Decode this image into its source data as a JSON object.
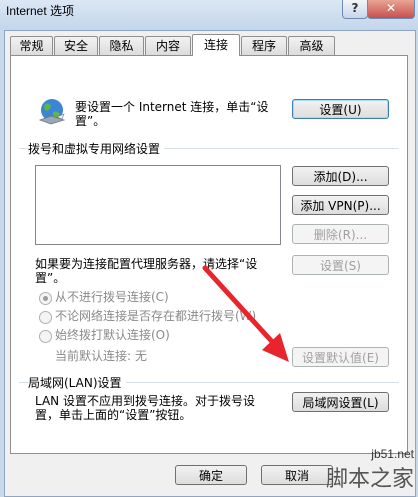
{
  "window": {
    "title": "Internet 选项",
    "help_label": "?",
    "close_label": "✕"
  },
  "tabs": [
    {
      "label": "常规"
    },
    {
      "label": "安全"
    },
    {
      "label": "隐私"
    },
    {
      "label": "内容"
    },
    {
      "label": "连接",
      "active": true
    },
    {
      "label": "程序"
    },
    {
      "label": "高级"
    }
  ],
  "setup": {
    "text_line1": "要设置一个 Internet 连接，单击“设",
    "text_line2": "置”。",
    "button_label": "设置(U)",
    "icon": "globe-network-icon"
  },
  "dialup": {
    "group_label": "拨号和虚拟专用网络设置",
    "add_label": "添加(D)...",
    "add_vpn_label": "添加 VPN(P)...",
    "delete_label": "删除(R)...",
    "proxy_text_line1": "如果要为连接配置代理服务器，请选择“设",
    "proxy_text_line2": "置”。",
    "settings_label": "设置(S)",
    "radios": [
      {
        "label": "从不进行拨号连接(C)",
        "checked": true
      },
      {
        "label": "不论网络连接是否存在都进行拨号(W)",
        "checked": false
      },
      {
        "label": "始终拨打默认连接(O)",
        "checked": false
      }
    ],
    "current_default_label": "当前默认连接:",
    "current_default_value": "无",
    "set_default_label": "设置默认值(E)"
  },
  "lan": {
    "group_label": "局域网(LAN)设置",
    "text_line1": "LAN 设置不应用到拨号连接。对于拨号设",
    "text_line2": "置，单击上面的“设置”按钮。",
    "button_label": "局域网设置(L)"
  },
  "footer": {
    "ok_label": "确定",
    "cancel_label": "取消"
  },
  "watermark": {
    "url": "jb51.net",
    "name": "脚本之家"
  },
  "colors": {
    "arrow": "#e8242c",
    "focus_border": "#3c7fb1"
  }
}
